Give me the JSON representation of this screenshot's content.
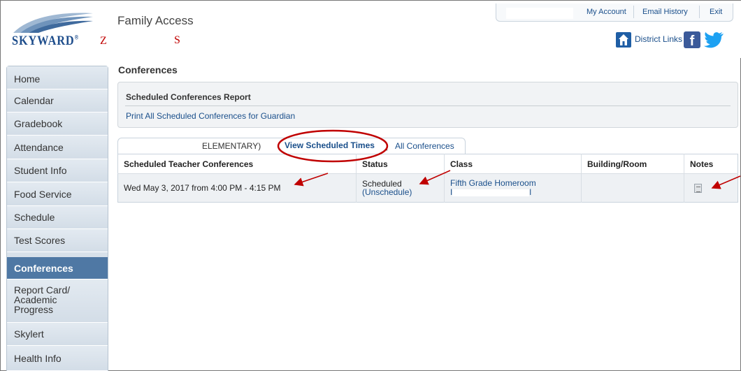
{
  "header": {
    "app_title": "Family Access",
    "logo_text": "SKYWARD",
    "logo_mark": "®",
    "student_initial_1": "Z",
    "student_initial_2": "S",
    "top_links": [
      "My Account",
      "Email History",
      "Exit"
    ],
    "district_links_label": "District Links",
    "district_icon": "building-icon",
    "social_icons": [
      "facebook-icon",
      "twitter-icon"
    ]
  },
  "sidebar": {
    "items": [
      {
        "label": "Home",
        "active": false
      },
      {
        "label": "Calendar",
        "active": false
      },
      {
        "label": "Gradebook",
        "active": false
      },
      {
        "label": "Attendance",
        "active": false
      },
      {
        "label": "Student Info",
        "active": false
      },
      {
        "label": "Food Service",
        "active": false
      },
      {
        "label": "Schedule",
        "active": false
      },
      {
        "label": "Test Scores",
        "active": false
      },
      {
        "label": "Conferences",
        "active": true
      },
      {
        "label": "Report Card/\nAcademic\nProgress",
        "active": false
      },
      {
        "label": "Skylert",
        "active": false
      },
      {
        "label": "Health Info",
        "active": false
      }
    ]
  },
  "main": {
    "page_title": "Conferences",
    "report": {
      "title": "Scheduled Conferences Report",
      "link": "Print All Scheduled Conferences for Guardian"
    },
    "tabs": {
      "school_label": "ELEMENTARY)",
      "view_scheduled": "View Scheduled Times",
      "separator": "|",
      "all_conferences": "All Conferences"
    },
    "table": {
      "headers": [
        "Scheduled Teacher Conferences",
        "Status",
        "Class",
        "Building/Room",
        "Notes"
      ],
      "row": {
        "time": "Wed May 3, 2017 from 4:00 PM - 4:15 PM",
        "status": "Scheduled",
        "unschedule": "(Unschedule)",
        "class_name": "Fifth Grade Homeroom",
        "class_teacher_start": "I",
        "class_teacher_end": "l",
        "building_room": "",
        "notes_icon": "notes-icon"
      }
    }
  },
  "colors": {
    "brand_blue": "#1f4e8c",
    "link_blue": "#1a4f8b",
    "active_nav": "#4f78a4",
    "annotation_red": "#c00000"
  }
}
